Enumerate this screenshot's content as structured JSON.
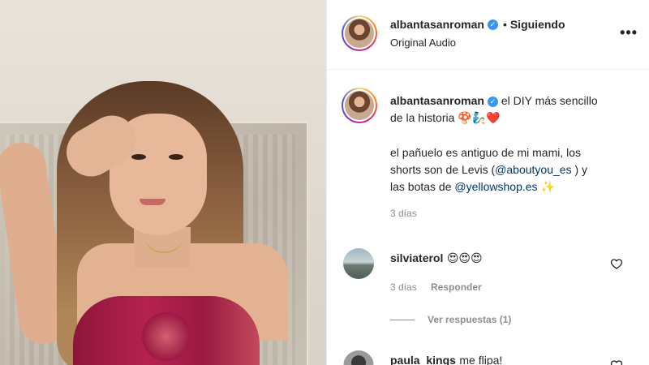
{
  "post": {
    "author": "albantasanroman",
    "follow_status": "Siguiendo",
    "separator": "•",
    "audio_label": "Original Audio",
    "more_label": "•••"
  },
  "caption": {
    "author": "albantasanroman",
    "line1": "el DIY más sencillo de la historia",
    "line1_emojis": "🍄🧞❤️",
    "line2_a": "el pañuelo es antiguo de mi mami, los shorts son de Levis (",
    "line2_link1": "@aboutyou_es",
    "line2_b": " ) y las botas de ",
    "line2_link2": "@yellowshop.es",
    "line2_emoji": "✨",
    "time": "3 días"
  },
  "comments": [
    {
      "user": "silviaterol",
      "text": "😍😍😍",
      "time": "3 días",
      "reply_label": "Responder",
      "view_replies": "Ver respuestas (1)"
    },
    {
      "user": "paula_kings",
      "text": "me flipa!"
    }
  ],
  "colors": {
    "link": "#00376b",
    "verified": "#3897f0",
    "meta": "#8e8e8e"
  }
}
